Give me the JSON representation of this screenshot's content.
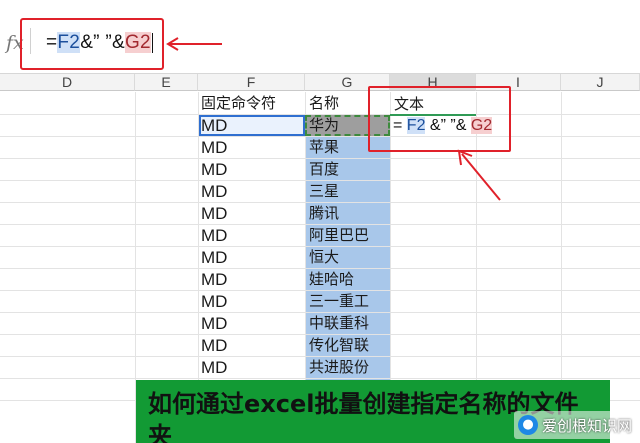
{
  "formula_bar": {
    "fx_label": "fx",
    "formula_parts": [
      "=",
      "F2",
      "&” ”&",
      "G2"
    ]
  },
  "columns": [
    "D",
    "E",
    "F",
    "G",
    "H",
    "I",
    "J"
  ],
  "headers": {
    "F1": "固定命令符",
    "G1": "名称",
    "H1": "文本"
  },
  "rows": [
    {
      "f": "MD",
      "g": "华为"
    },
    {
      "f": "MD",
      "g": "苹果"
    },
    {
      "f": "MD",
      "g": "百度"
    },
    {
      "f": "MD",
      "g": "三星"
    },
    {
      "f": "MD",
      "g": "腾讯"
    },
    {
      "f": "MD",
      "g": "阿里巴巴"
    },
    {
      "f": "MD",
      "g": "恒大"
    },
    {
      "f": "MD",
      "g": "娃哈哈"
    },
    {
      "f": "MD",
      "g": "三一重工"
    },
    {
      "f": "MD",
      "g": "中联重科"
    },
    {
      "f": "MD",
      "g": "传化智联"
    },
    {
      "f": "MD",
      "g": "共进股份"
    }
  ],
  "h2_formula": [
    "= ",
    "F2",
    " &” ”& ",
    "G2"
  ],
  "banner": {
    "text": "如何通过excel批量创建指定名称的文件夹"
  },
  "watermark": {
    "text": "爱创根知识网",
    "logo": "●"
  },
  "colors": {
    "annotation_red": "#e0212a",
    "banner_green": "#129a34",
    "column_g_fill": "#a8c7ea",
    "ref_f": "#cfe0f7",
    "ref_g": "#f6cfd0"
  }
}
